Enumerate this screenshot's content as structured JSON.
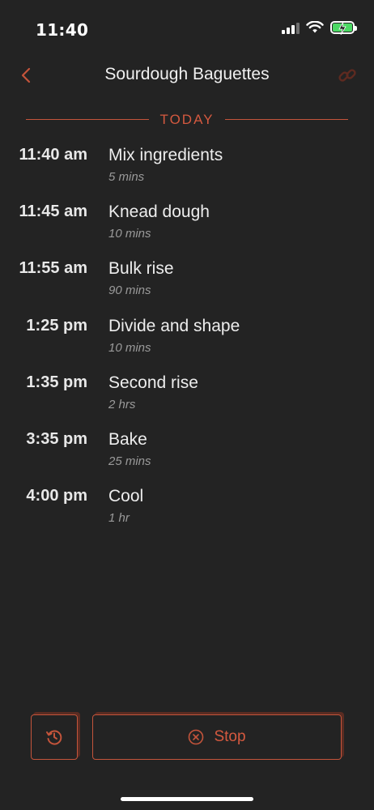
{
  "status_bar": {
    "time": "11:40",
    "icons": [
      "cellular-signal-icon",
      "wifi-icon",
      "battery-charging-icon"
    ],
    "battery_color": "#4cd964"
  },
  "header": {
    "title": "Sourdough Baguettes",
    "back_icon": "chevron-left-icon",
    "share_icon": "link-icon"
  },
  "section": {
    "label": "TODAY"
  },
  "schedule": [
    {
      "time": "11:40 am",
      "name": "Mix ingredients",
      "duration": "5 mins"
    },
    {
      "time": "11:45 am",
      "name": "Knead dough",
      "duration": "10 mins"
    },
    {
      "time": "11:55 am",
      "name": "Bulk rise",
      "duration": "90 mins"
    },
    {
      "time": "1:25 pm",
      "name": "Divide and shape",
      "duration": "10 mins"
    },
    {
      "time": "1:35 pm",
      "name": "Second rise",
      "duration": "2 hrs"
    },
    {
      "time": "3:35 pm",
      "name": "Bake",
      "duration": "25 mins"
    },
    {
      "time": "4:00 pm",
      "name": "Cool",
      "duration": "1 hr"
    }
  ],
  "actions": {
    "history_icon": "history-icon",
    "stop_icon": "close-circle-icon",
    "stop_label": "Stop"
  },
  "colors": {
    "accent": "#c4543b",
    "background": "#232323"
  }
}
